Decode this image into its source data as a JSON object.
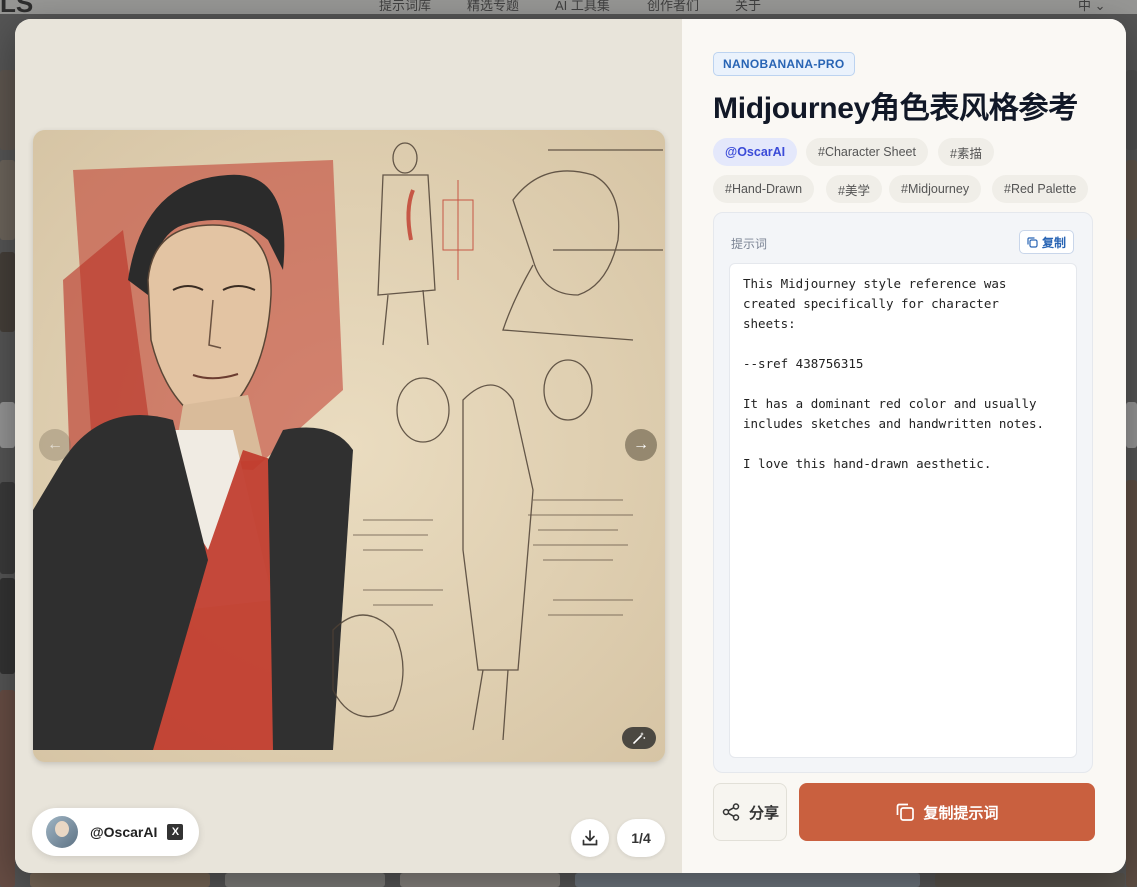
{
  "nav": {
    "logo": "LS",
    "items": [
      "提示词库",
      "精选专题",
      "AI 工具集",
      "创作者们",
      "关于"
    ],
    "language": "中"
  },
  "modal": {
    "model_badge": "NANOBANANA-PRO",
    "title": "Midjourney角色表风格参考",
    "tags": [
      "@OscarAI",
      "#Character Sheet",
      "#素描",
      "#Hand-Drawn",
      "#美学",
      "#Midjourney",
      "#Red Palette"
    ],
    "prompt_label": "提示词",
    "copy_small_label": "复制",
    "prompt_text": "This Midjourney style reference was\ncreated specifically for character\nsheets:\n\n--sref 438756315\n\nIt has a dominant red color and usually\nincludes sketches and handwritten notes.\n\nI love this hand-drawn aesthetic.",
    "share_label": "分享",
    "copy_prompt_label": "复制提示词"
  },
  "author": {
    "name": "@OscarAI",
    "social": "X"
  },
  "gallery": {
    "page_indicator": "1/4"
  },
  "colors": {
    "accent": "#c9603f",
    "badge_blue": "#2864b4",
    "author_tag": "#3b4bd8"
  },
  "icons": {
    "prev": "arrow-left-icon",
    "next": "arrow-right-icon",
    "magic": "magic-wand-icon",
    "download": "download-icon",
    "copy": "copy-icon",
    "share": "share-icon",
    "x_logo": "x-logo-icon",
    "chevron": "chevron-down-icon"
  }
}
